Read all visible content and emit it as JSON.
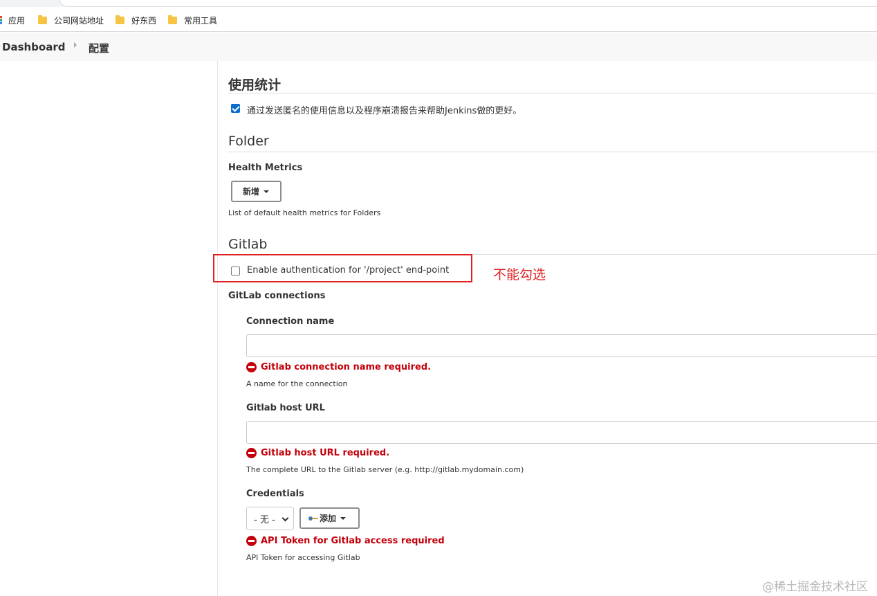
{
  "bookmarks": [
    {
      "label": "应用",
      "icon": "apps-grid-icon"
    },
    {
      "label": "公司网站地址",
      "icon": "folder-icon"
    },
    {
      "label": "好东西",
      "icon": "folder-icon"
    },
    {
      "label": "常用工具",
      "icon": "folder-icon"
    }
  ],
  "breadcrumb": {
    "home": "Dashboard",
    "current": "配置"
  },
  "usage": {
    "title": "使用统计",
    "checkbox_label": "通过发送匿名的使用信息以及程序崩溃报告来帮助Jenkins做的更好。",
    "checked": true
  },
  "folder": {
    "title": "Folder",
    "health_metrics_label": "Health Metrics",
    "add_button": "新增",
    "description": "List of default health metrics for Folders"
  },
  "gitlab": {
    "title": "Gitlab",
    "enable_auth_label": "Enable authentication for '/project' end-point",
    "enable_auth_checked": false,
    "connections_label": "GitLab connections",
    "connection_name": {
      "label": "Connection name",
      "value": "",
      "error": "Gitlab connection name required.",
      "description": "A name for the connection"
    },
    "host_url": {
      "label": "Gitlab host URL",
      "value": "",
      "error": "Gitlab host URL required.",
      "description": "The complete URL to the Gitlab server (e.g. http://gitlab.mydomain.com)"
    },
    "credentials": {
      "label": "Credentials",
      "selected": "- 无 -",
      "add_button": "添加",
      "error": "API Token for Gitlab access required",
      "description": "API Token for accessing Gitlab"
    }
  },
  "annotation": {
    "text": "不能勾选",
    "color": "#e02020"
  },
  "watermark": "@稀土掘金技术社区",
  "colors": {
    "error": "#c4000a",
    "checkbox": "#0a6ccd",
    "breadcrumb_bg": "#f8f8f8"
  }
}
